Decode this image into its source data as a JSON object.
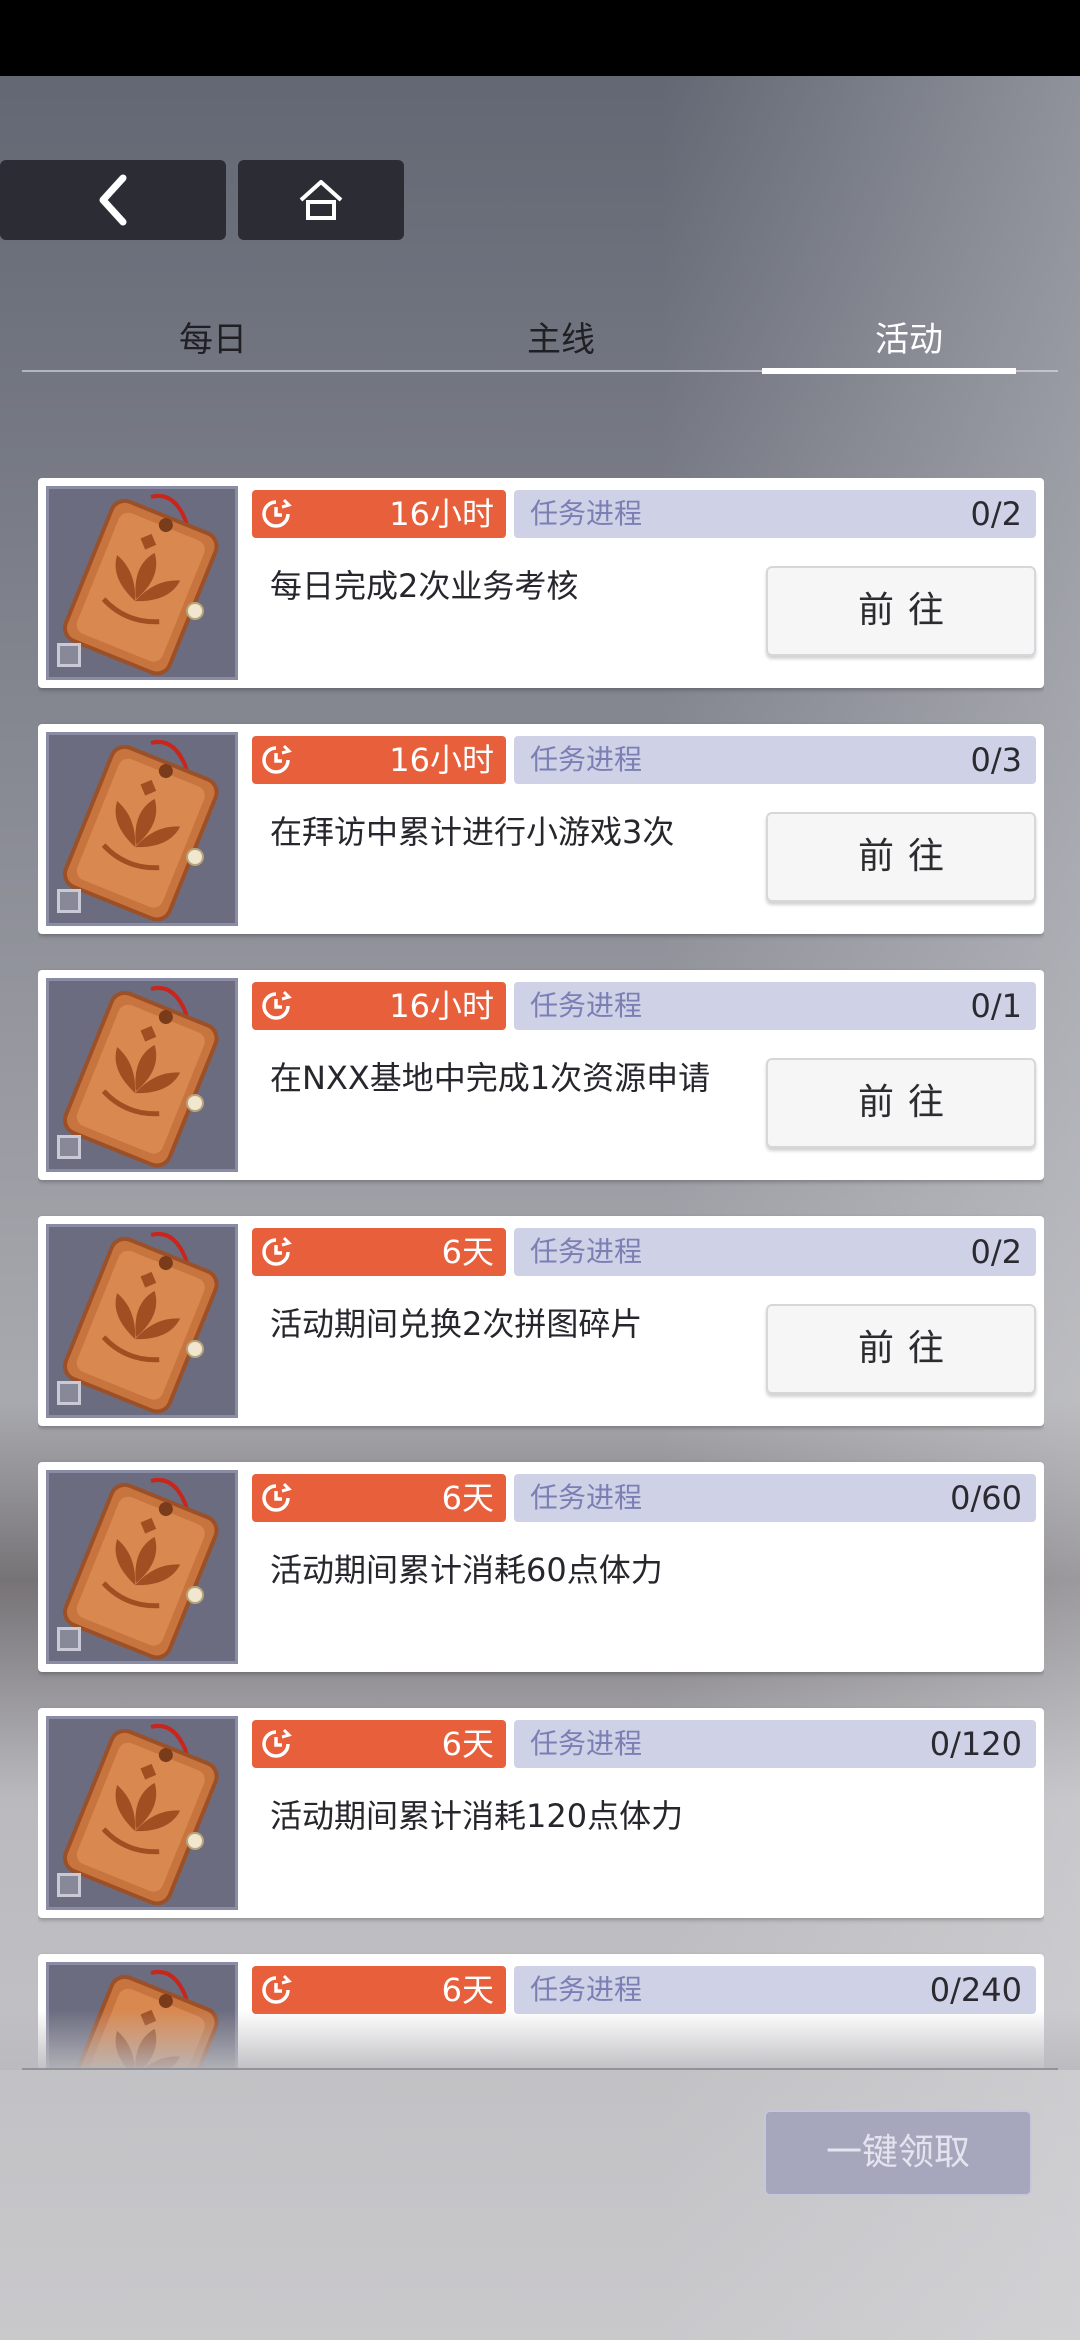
{
  "tabs": [
    {
      "label": "每日"
    },
    {
      "label": "主线"
    },
    {
      "label": "活动",
      "active": true
    }
  ],
  "progress_label": "任务进程",
  "tasks": [
    {
      "timer": "16小时",
      "progress": "0/2",
      "text": "每日完成2次业务考核",
      "button": "前往"
    },
    {
      "timer": "16小时",
      "progress": "0/3",
      "text": "在拜访中累计进行小游戏3次",
      "button": "前往"
    },
    {
      "timer": "16小时",
      "progress": "0/1",
      "text": "在NXX基地中完成1次资源申请",
      "button": "前往"
    },
    {
      "timer": "6天",
      "progress": "0/2",
      "text": "活动期间兑换2次拼图碎片",
      "button": "前往"
    },
    {
      "timer": "6天",
      "progress": "0/60",
      "text": "活动期间累计消耗60点体力",
      "button": ""
    },
    {
      "timer": "6天",
      "progress": "0/120",
      "text": "活动期间累计消耗120点体力",
      "button": ""
    },
    {
      "timer": "6天",
      "progress": "0/240",
      "text": "",
      "button": ""
    }
  ],
  "claim_all_label": "一键领取",
  "icons": {
    "back": "chevron-left-icon",
    "home": "home-icon",
    "timer": "clock-icon",
    "item": "lotus-tag-icon"
  },
  "colors": {
    "timer_bg": "#e85f3b",
    "progress_bg": "#cfd1e6",
    "active_tab": "#ffffff"
  }
}
